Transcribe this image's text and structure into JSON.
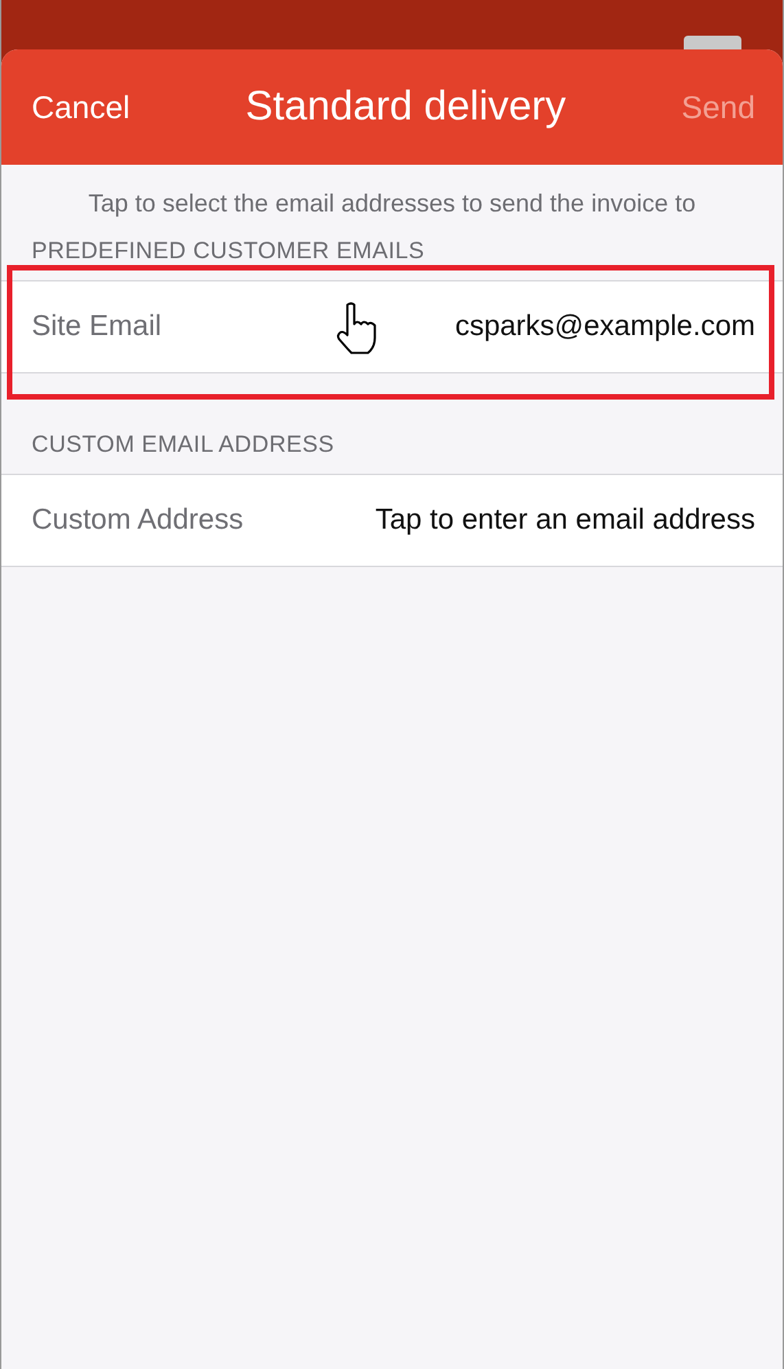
{
  "nav": {
    "cancel": "Cancel",
    "title": "Standard delivery",
    "send": {
      "label": "Send",
      "disabled": true
    }
  },
  "instruction": "Tap to select the email addresses to send the invoice to",
  "sections": [
    {
      "header": "PREDEFINED CUSTOMER EMAILS",
      "rows": [
        {
          "label": "Site Email",
          "value": "csparks@example.com",
          "highlighted": true
        }
      ]
    },
    {
      "header": "CUSTOM EMAIL ADDRESS",
      "rows": [
        {
          "label": "Custom Address",
          "value": "Tap to enter an email address",
          "highlighted": false
        }
      ]
    }
  ]
}
